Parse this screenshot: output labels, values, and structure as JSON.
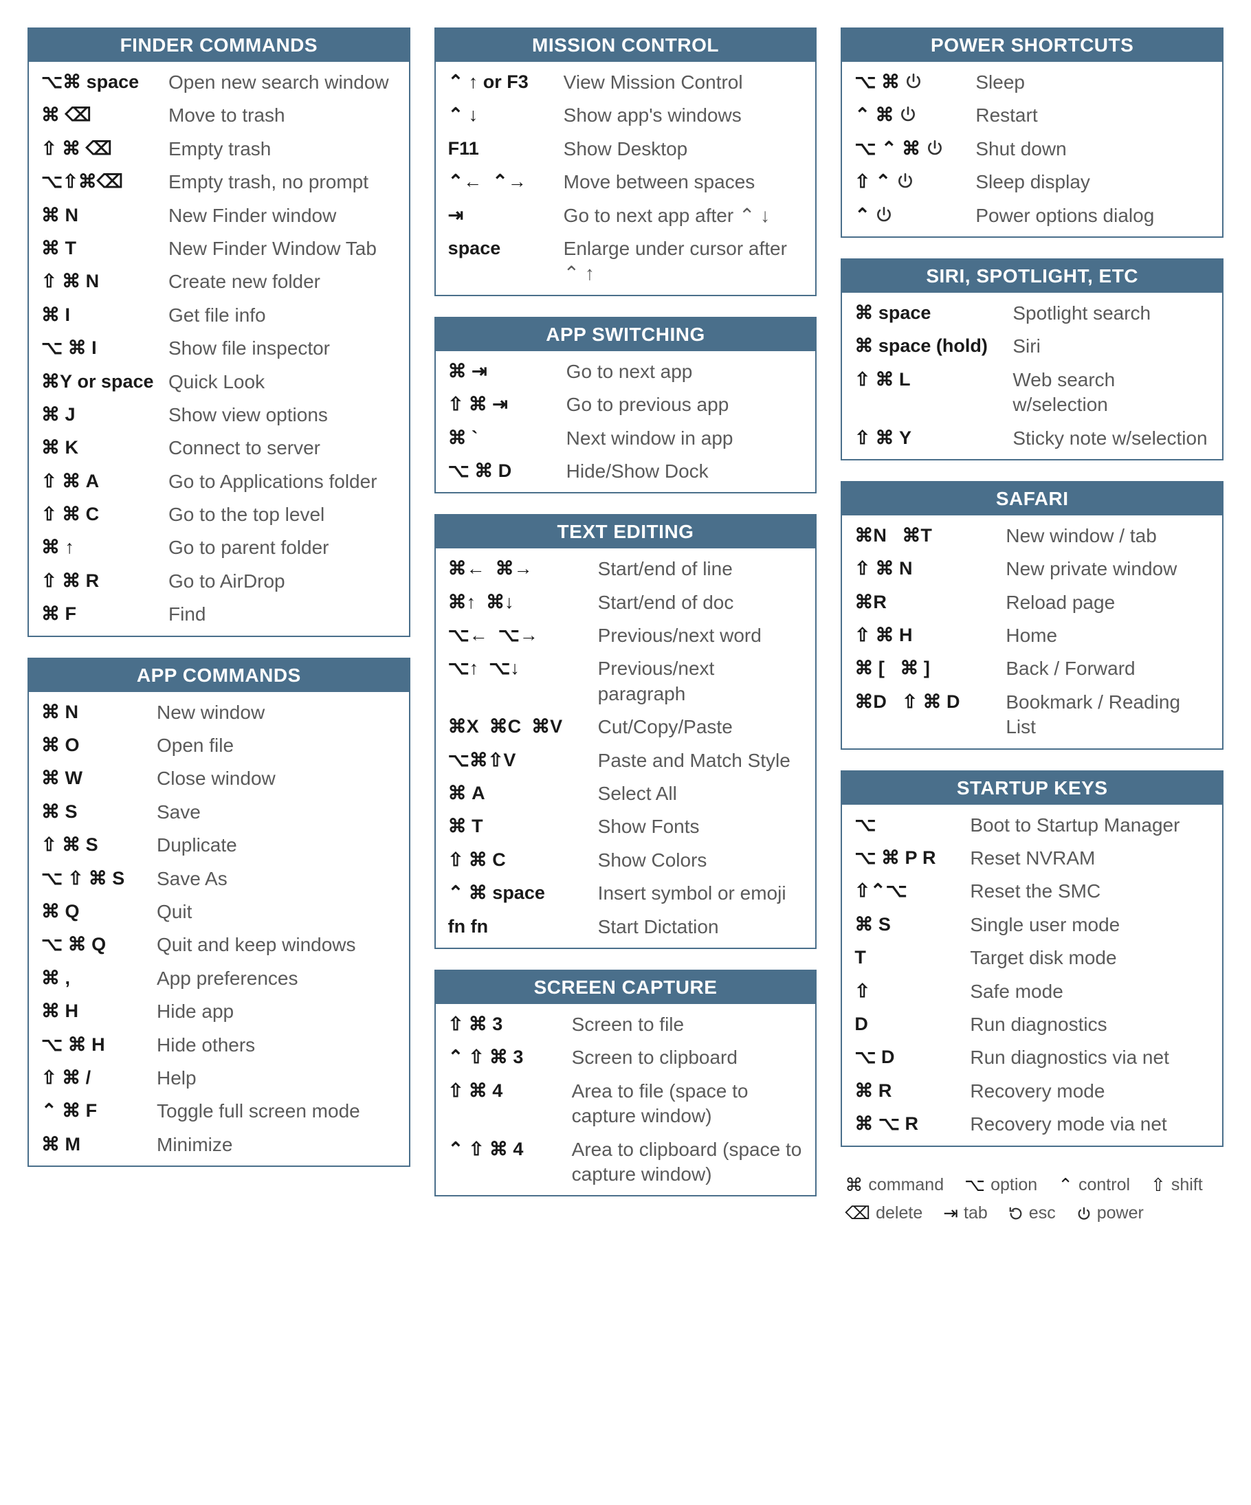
{
  "glyphs": {
    "command": "⌘",
    "option": "⌥",
    "control": "⌃",
    "shift": "⇧",
    "delete": "⌫",
    "tab": "⇥",
    "esc": "⟲",
    "up": "↑",
    "down": "↓",
    "left": "←",
    "right": "→",
    "power": "⏻",
    "space": "space",
    "fn": "fn"
  },
  "columns": [
    [
      {
        "title": "FINDER COMMANDS",
        "keywidth": "185px",
        "rows": [
          {
            "keys": [
              "option",
              "command",
              "str: ",
              "str:space"
            ],
            "desc": "Open new search window"
          },
          {
            "keys": [
              "command",
              "str: ",
              "delete"
            ],
            "desc": "Move to trash"
          },
          {
            "keys": [
              "shift",
              "str: ",
              "command",
              "str: ",
              "delete"
            ],
            "desc": "Empty trash"
          },
          {
            "keys": [
              "option",
              "shift",
              "command",
              "delete"
            ],
            "desc": "Empty trash, no prompt"
          },
          {
            "keys": [
              "command",
              "str: N"
            ],
            "desc": "New Finder window"
          },
          {
            "keys": [
              "command",
              "str: T"
            ],
            "desc": "New Finder Window Tab"
          },
          {
            "keys": [
              "shift",
              "str: ",
              "command",
              "str: N"
            ],
            "desc": "Create new folder"
          },
          {
            "keys": [
              "command",
              "str: I"
            ],
            "desc": "Get file info"
          },
          {
            "keys": [
              "option",
              "str: ",
              "command",
              "str: I"
            ],
            "desc": "Show file inspector"
          },
          {
            "keys": [
              "command",
              "str:Y or space"
            ],
            "desc": "Quick Look"
          },
          {
            "keys": [
              "command",
              "str: J"
            ],
            "desc": "Show view options"
          },
          {
            "keys": [
              "command",
              "str: K"
            ],
            "desc": "Connect to server"
          },
          {
            "keys": [
              "shift",
              "str: ",
              "command",
              "str: A"
            ],
            "desc": "Go to Applications folder"
          },
          {
            "keys": [
              "shift",
              "str: ",
              "command",
              "str: C"
            ],
            "desc": "Go to the top level"
          },
          {
            "keys": [
              "command",
              "str: ",
              "up"
            ],
            "desc": "Go to parent folder"
          },
          {
            "keys": [
              "shift",
              "str: ",
              "command",
              "str: R"
            ],
            "desc": "Go to AirDrop"
          },
          {
            "keys": [
              "command",
              "str: F"
            ],
            "desc": "Find"
          }
        ]
      },
      {
        "title": "APP COMMANDS",
        "keywidth": "168px",
        "rows": [
          {
            "keys": [
              "command",
              "str: N"
            ],
            "desc": "New window"
          },
          {
            "keys": [
              "command",
              "str: O"
            ],
            "desc": "Open file"
          },
          {
            "keys": [
              "command",
              "str: W"
            ],
            "desc": "Close window"
          },
          {
            "keys": [
              "command",
              "str: S"
            ],
            "desc": "Save"
          },
          {
            "keys": [
              "shift",
              "str: ",
              "command",
              "str: S"
            ],
            "desc": "Duplicate"
          },
          {
            "keys": [
              "option",
              "str: ",
              "shift",
              "str: ",
              "command",
              "str: S"
            ],
            "desc": "Save As"
          },
          {
            "keys": [
              "command",
              "str: Q"
            ],
            "desc": "Quit"
          },
          {
            "keys": [
              "option",
              "str: ",
              "command",
              "str: Q"
            ],
            "desc": "Quit and keep windows"
          },
          {
            "keys": [
              "command",
              "str: ,"
            ],
            "desc": "App preferences"
          },
          {
            "keys": [
              "command",
              "str: H"
            ],
            "desc": "Hide app"
          },
          {
            "keys": [
              "option",
              "str: ",
              "command",
              "str: H"
            ],
            "desc": "Hide others"
          },
          {
            "keys": [
              "shift",
              "str: ",
              "command",
              "str: /"
            ],
            "desc": "Help"
          },
          {
            "keys": [
              "control",
              "str: ",
              "command",
              "str: F"
            ],
            "desc": "Toggle full screen mode"
          },
          {
            "keys": [
              "command",
              "str: M"
            ],
            "desc": "Minimize"
          }
        ]
      }
    ],
    [
      {
        "title": "MISSION CONTROL",
        "keywidth": "168px",
        "rows": [
          {
            "keys": [
              "control",
              "str: ",
              "up",
              "str: or F3"
            ],
            "desc": "View Mission Control"
          },
          {
            "keys": [
              "control",
              "str: ",
              "down"
            ],
            "desc": "Show app's windows"
          },
          {
            "keys": [
              "str:F11"
            ],
            "desc": "Show Desktop"
          },
          {
            "keys": [
              "control",
              "left",
              "str:  ",
              "control",
              "right"
            ],
            "desc": "Move between spaces"
          },
          {
            "keys": [
              "tab"
            ],
            "desc": "Go to next app after ⌃ ↓"
          },
          {
            "keys": [
              "str:space"
            ],
            "desc": "Enlarge under cursor after ⌃ ↑"
          }
        ]
      },
      {
        "title": "APP SWITCHING",
        "keywidth": "172px",
        "rows": [
          {
            "keys": [
              "command",
              "str: ",
              "tab"
            ],
            "desc": "Go to next app"
          },
          {
            "keys": [
              "shift",
              "str: ",
              "command",
              "str: ",
              "tab"
            ],
            "desc": "Go to previous app"
          },
          {
            "keys": [
              "command",
              "str: `"
            ],
            "desc": "Next window in app"
          },
          {
            "keys": [
              "option",
              "str: ",
              "command",
              "str: D"
            ],
            "desc": "Hide/Show Dock"
          }
        ]
      },
      {
        "title": "TEXT EDITING",
        "keywidth": "218px",
        "rows": [
          {
            "keys": [
              "command",
              "left",
              "str:  ",
              "command",
              "right"
            ],
            "desc": "Start/end of line"
          },
          {
            "keys": [
              "command",
              "up",
              "str:  ",
              "command",
              "down"
            ],
            "desc": "Start/end of doc"
          },
          {
            "keys": [
              "option",
              "left",
              "str:  ",
              "option",
              "right"
            ],
            "desc": "Previous/next word"
          },
          {
            "keys": [
              "option",
              "up",
              "str:  ",
              "option",
              "down"
            ],
            "desc": "Previous/next paragraph"
          },
          {
            "keys": [
              "command",
              "str:X  ",
              "command",
              "str:C  ",
              "command",
              "str:V"
            ],
            "desc": "Cut/Copy/Paste"
          },
          {
            "keys": [
              "option",
              "command",
              "shift",
              "str:V"
            ],
            "desc": "Paste and Match Style"
          },
          {
            "keys": [
              "command",
              "str: A"
            ],
            "desc": "Select All"
          },
          {
            "keys": [
              "command",
              "str: T"
            ],
            "desc": "Show Fonts"
          },
          {
            "keys": [
              "shift",
              "str: ",
              "command",
              "str: C"
            ],
            "desc": "Show Colors"
          },
          {
            "keys": [
              "control",
              "str: ",
              "command",
              "str: space"
            ],
            "desc": "Insert symbol or emoji"
          },
          {
            "keys": [
              "str:fn fn"
            ],
            "desc": "Start Dictation"
          }
        ]
      },
      {
        "title": "SCREEN CAPTURE",
        "keywidth": "180px",
        "rows": [
          {
            "keys": [
              "shift",
              "str: ",
              "command",
              "str: 3"
            ],
            "desc": "Screen to file"
          },
          {
            "keys": [
              "control",
              "str: ",
              "shift",
              "str: ",
              "command",
              "str: 3"
            ],
            "desc": "Screen to clipboard"
          },
          {
            "keys": [
              "shift",
              "str: ",
              "command",
              "str: 4"
            ],
            "desc": "Area to file (space to capture window)"
          },
          {
            "keys": [
              "control",
              "str: ",
              "shift",
              "str: ",
              "command",
              "str: 4"
            ],
            "desc": "Area to clipboard (space to capture window)"
          }
        ]
      }
    ],
    [
      {
        "title": "POWER SHORTCUTS",
        "keywidth": "176px",
        "rows": [
          {
            "keys": [
              "option",
              "str: ",
              "command",
              "str: ",
              "power"
            ],
            "desc": "Sleep"
          },
          {
            "keys": [
              "control",
              "str: ",
              "command",
              "str: ",
              "power"
            ],
            "desc": "Restart"
          },
          {
            "keys": [
              "option",
              "str: ",
              "control",
              "str: ",
              "command",
              "str: ",
              "power"
            ],
            "desc": "Shut down"
          },
          {
            "keys": [
              "shift",
              "str: ",
              "control",
              "str: ",
              "power"
            ],
            "desc": "Sleep display"
          },
          {
            "keys": [
              "control",
              "str: ",
              "power"
            ],
            "desc": "Power options dialog"
          }
        ]
      },
      {
        "title": "SIRI, SPOTLIGHT, ETC",
        "keywidth": "230px",
        "rows": [
          {
            "keys": [
              "command",
              "str: space"
            ],
            "desc": "Spotlight search"
          },
          {
            "keys": [
              "command",
              "str: space (hold)"
            ],
            "desc": "Siri"
          },
          {
            "keys": [
              "shift",
              "str: ",
              "command",
              "str: L"
            ],
            "desc": "Web search w/selection"
          },
          {
            "keys": [
              "shift",
              "str: ",
              "command",
              "str: Y"
            ],
            "desc": "Sticky note w/selection"
          }
        ]
      },
      {
        "title": "SAFARI",
        "keywidth": "220px",
        "rows": [
          {
            "keys": [
              "command",
              "str:N   ",
              "command",
              "str:T"
            ],
            "desc": "New window / tab"
          },
          {
            "keys": [
              "shift",
              "str: ",
              "command",
              "str: N"
            ],
            "desc": "New private window"
          },
          {
            "keys": [
              "command",
              "str:R"
            ],
            "desc": "Reload page"
          },
          {
            "keys": [
              "shift",
              "str: ",
              "command",
              "str: H"
            ],
            "desc": "Home"
          },
          {
            "keys": [
              "command",
              "str: [   ",
              "command",
              "str: ]"
            ],
            "desc": "Back / Forward"
          },
          {
            "keys": [
              "command",
              "str:D   ",
              "shift",
              "str: ",
              "command",
              "str: D"
            ],
            "desc": "Bookmark / Reading List"
          }
        ]
      },
      {
        "title": "STARTUP KEYS",
        "keywidth": "168px",
        "rows": [
          {
            "keys": [
              "option"
            ],
            "desc": "Boot to Startup Manager"
          },
          {
            "keys": [
              "option",
              "str: ",
              "command",
              "str: P R"
            ],
            "desc": "Reset NVRAM"
          },
          {
            "keys": [
              "shift",
              "control",
              "option"
            ],
            "desc": "Reset the SMC"
          },
          {
            "keys": [
              "command",
              "str: S"
            ],
            "desc": "Single user mode"
          },
          {
            "keys": [
              "str:T"
            ],
            "desc": "Target disk mode"
          },
          {
            "keys": [
              "shift"
            ],
            "desc": "Safe mode"
          },
          {
            "keys": [
              "str:D"
            ],
            "desc": "Run diagnostics"
          },
          {
            "keys": [
              "option",
              "str: D"
            ],
            "desc": "Run diagnostics via net"
          },
          {
            "keys": [
              "command",
              "str: R"
            ],
            "desc": "Recovery mode"
          },
          {
            "keys": [
              "command",
              "str: ",
              "option",
              "str: R"
            ],
            "desc": "Recovery mode via net"
          }
        ]
      },
      {
        "legend": [
          {
            "sym": "command",
            "label": "command"
          },
          {
            "sym": "option",
            "label": "option"
          },
          {
            "sym": "control",
            "label": "control"
          },
          {
            "sym": "shift",
            "label": "shift"
          },
          {
            "sym": "delete",
            "label": "delete"
          },
          {
            "sym": "tab",
            "label": "tab"
          },
          {
            "sym": "esc",
            "label": "esc"
          },
          {
            "sym": "power",
            "label": "power"
          }
        ]
      }
    ]
  ]
}
